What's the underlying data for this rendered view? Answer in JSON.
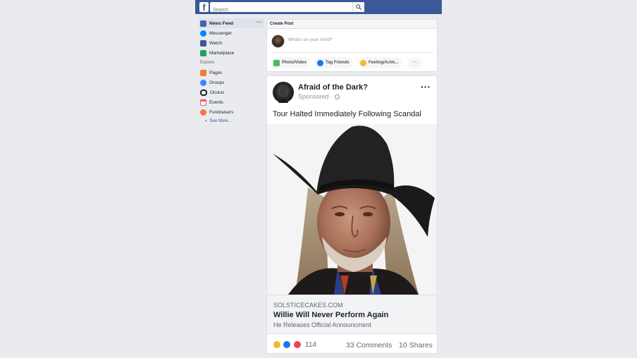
{
  "topbar": {
    "logo": "f",
    "search_placeholder": "Search",
    "search_icon": "magnifier-icon",
    "brand_color": "#3b5998"
  },
  "sidebar": {
    "items": [
      {
        "label": "News Feed",
        "icon": "news-feed-icon",
        "color": "#4267b2",
        "active": true,
        "more": "···"
      },
      {
        "label": "Messenger",
        "icon": "messenger-icon",
        "color": "#0084ff"
      },
      {
        "label": "Watch",
        "icon": "watch-icon",
        "color": "#3b5998"
      },
      {
        "label": "Marketplace",
        "icon": "marketplace-icon",
        "color": "#20a162"
      }
    ],
    "explore_title": "Explore",
    "explore": [
      {
        "label": "Pages",
        "icon": "flag-icon",
        "color": "#f5793b"
      },
      {
        "label": "Groups",
        "icon": "groups-icon",
        "color": "#4080ff"
      },
      {
        "label": "Oculus",
        "icon": "oculus-icon",
        "color": "#1c1e21"
      },
      {
        "label": "Events",
        "icon": "calendar-icon",
        "color": "#f35369"
      },
      {
        "label": "Fundraisers",
        "icon": "fundraiser-icon",
        "color": "#f5793b"
      }
    ],
    "see_more": "See More..."
  },
  "create_post": {
    "title": "Create Post",
    "placeholder": "What's on your mind?",
    "actions": [
      {
        "label": "Photo/Video",
        "icon": "photo-icon",
        "color": "#45bd62"
      },
      {
        "label": "Tag Friends",
        "icon": "tag-friends-icon",
        "color": "#1877f2"
      },
      {
        "label": "Feeling/Activ...",
        "icon": "feeling-icon",
        "color": "#f7b928"
      }
    ],
    "more": "···"
  },
  "post": {
    "page_name": "Afraid of the Dark?",
    "sponsored": "Sponsored · ",
    "menu": "···",
    "text": "Tour Halted Immediately Following Scandal",
    "image_alt": "portrait of an elderly man with long hair wearing a black cowboy hat",
    "link": {
      "domain": "SOLSTICECAKES.COM",
      "title": "Willie Will Never Perform Again",
      "description": "He Releases Official Announcment"
    },
    "reaction_count": "114",
    "comments": "33 Comments",
    "shares": "10 Shares",
    "reactions": [
      "sad-reaction-icon",
      "like-reaction-icon",
      "love-reaction-icon"
    ]
  }
}
